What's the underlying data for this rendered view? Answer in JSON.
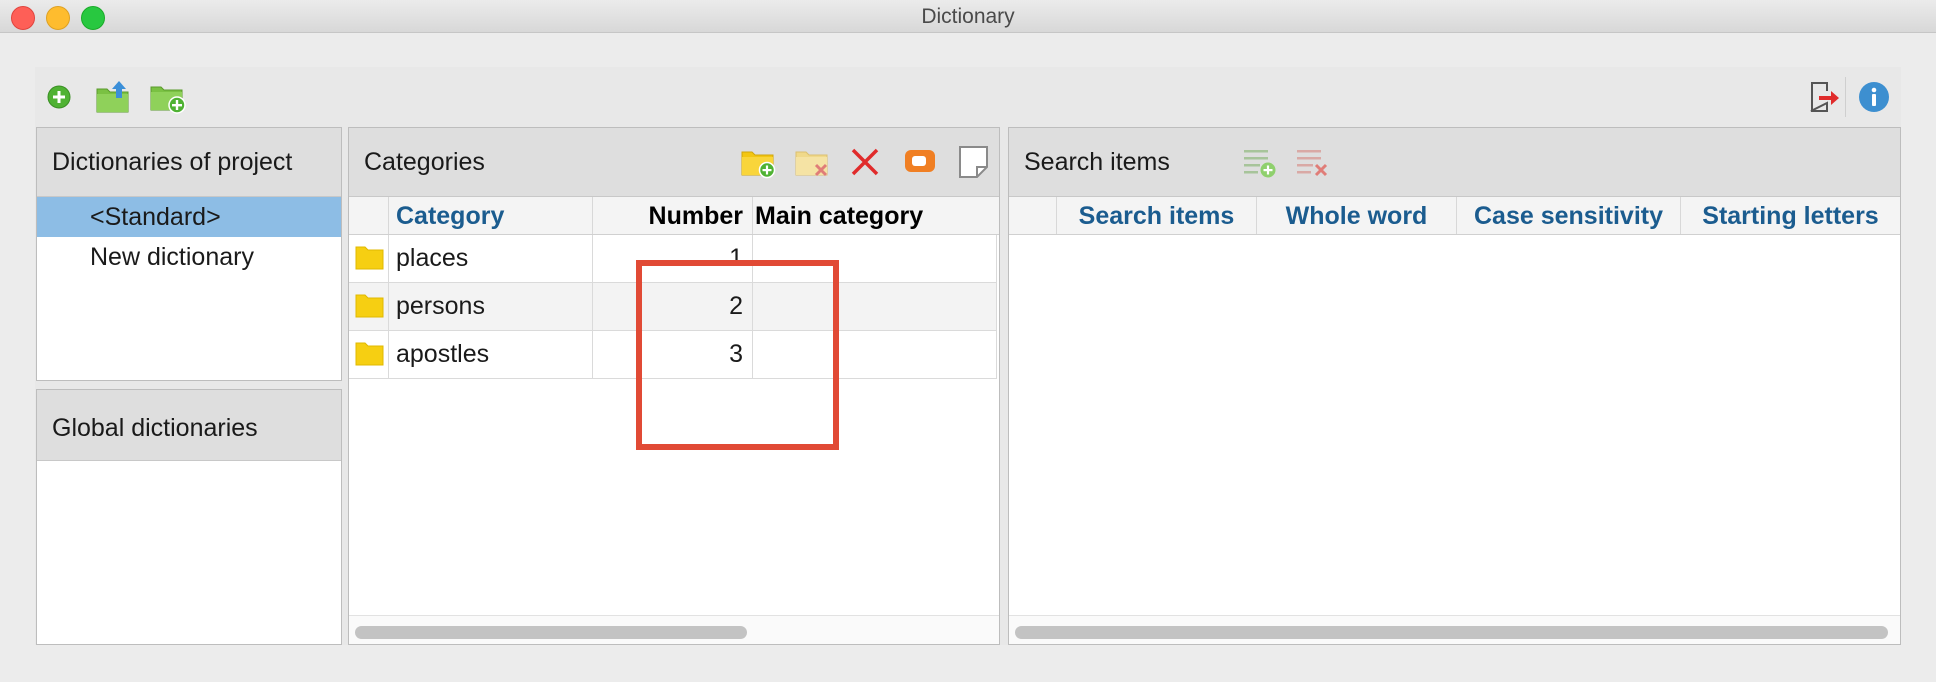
{
  "window": {
    "title": "Dictionary"
  },
  "toolbar": {
    "left_icons": [
      "add-circle-icon",
      "folder-upload-icon",
      "folder-add-icon"
    ],
    "right_icons": [
      "exit-icon",
      "info-icon"
    ]
  },
  "dictionaries": {
    "title": "Dictionaries of project",
    "items": [
      {
        "label": "<Standard>",
        "selected": true
      },
      {
        "label": "New dictionary",
        "selected": false
      }
    ]
  },
  "global": {
    "title": "Global dictionaries"
  },
  "categories": {
    "title": "Categories",
    "columns": [
      "Category",
      "Number",
      "Main category"
    ],
    "rows": [
      {
        "category": "places",
        "number": "1",
        "main": ""
      },
      {
        "category": "persons",
        "number": "2",
        "main": ""
      },
      {
        "category": "apostles",
        "number": "3",
        "main": ""
      }
    ],
    "tool_icons": [
      "folder-add-icon",
      "folder-delete-icon",
      "delete-x-icon",
      "tag-icon",
      "memo-icon"
    ]
  },
  "search": {
    "title": "Search items",
    "columns": [
      "Search items",
      "Whole word",
      "Case sensitivity",
      "Starting letters"
    ],
    "tool_icons": [
      "list-add-icon",
      "list-remove-icon"
    ]
  },
  "colors": {
    "accent": "#1b5c8f",
    "selection": "#8dbde5",
    "highlight": "#e14a35"
  }
}
